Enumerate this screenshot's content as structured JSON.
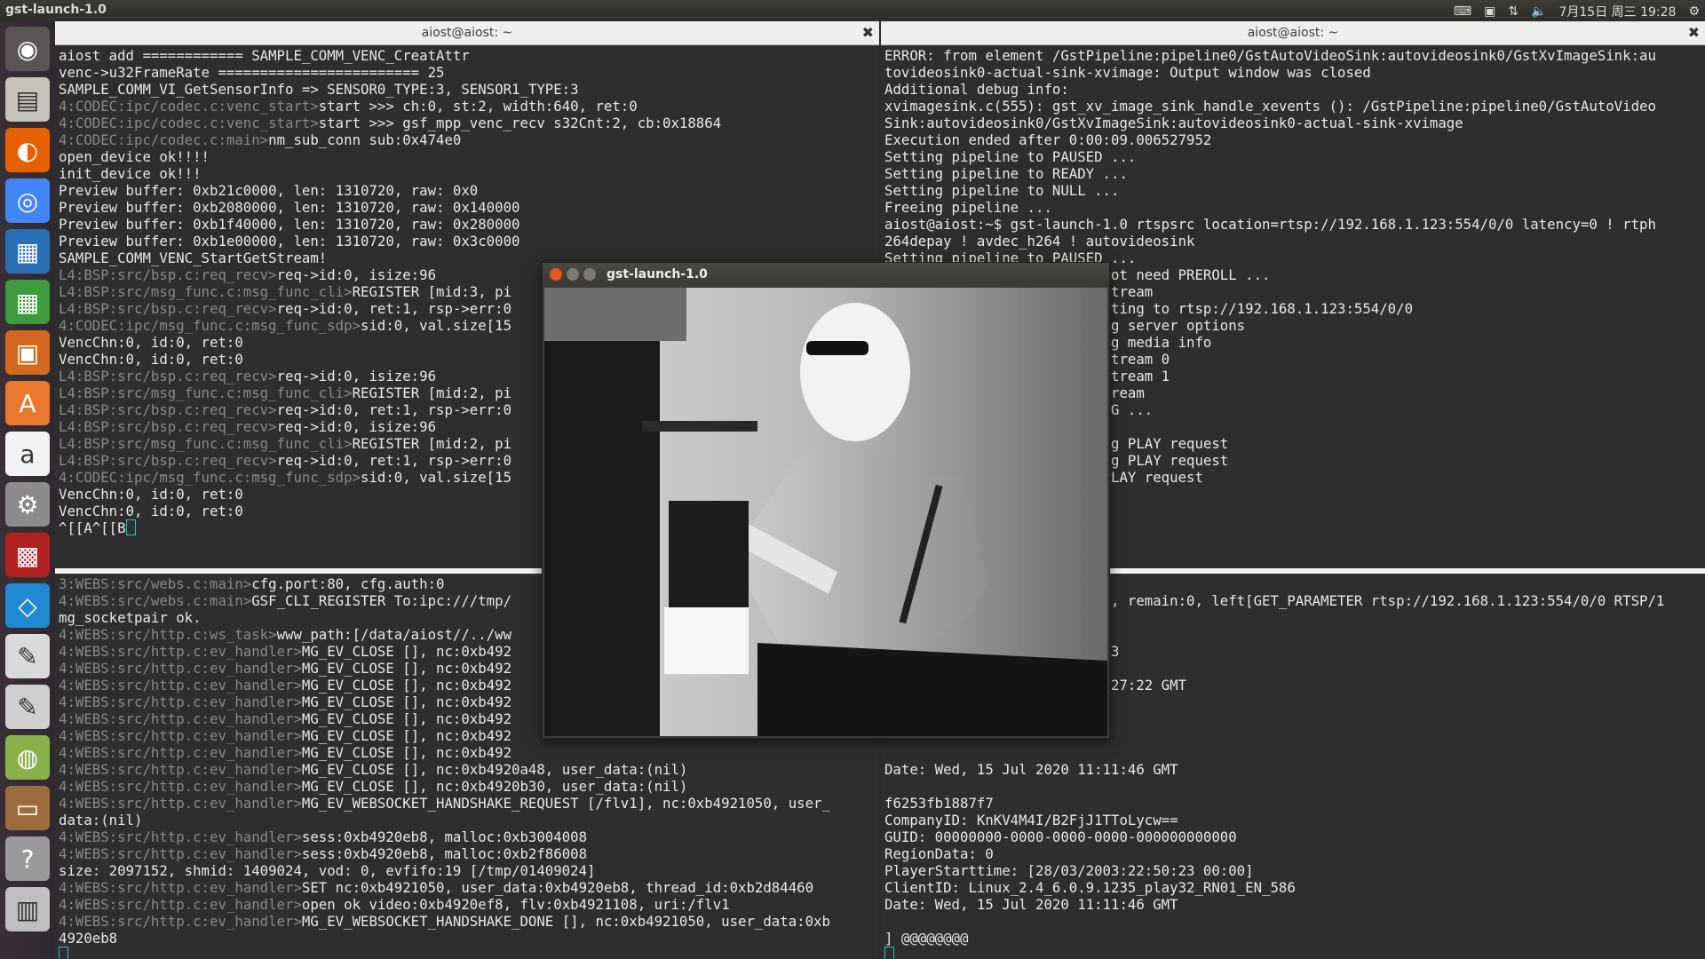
{
  "topbar": {
    "app_name": "gst-launch-1.0",
    "clock": "7月15日 周三 19:28"
  },
  "launcher": [
    {
      "icon": "dash-home-icon",
      "color": "#5a5656"
    },
    {
      "icon": "files-icon",
      "color": "#c7c3bc"
    },
    {
      "icon": "firefox-icon",
      "color": "#e66000"
    },
    {
      "icon": "chrome-icon",
      "color": "#4285f4"
    },
    {
      "icon": "writer-icon",
      "color": "#2a6fb6"
    },
    {
      "icon": "calc-icon",
      "color": "#3e9a3e"
    },
    {
      "icon": "impress-icon",
      "color": "#d2691e"
    },
    {
      "icon": "software-center-icon",
      "color": "#e9772e"
    },
    {
      "icon": "amazon-icon",
      "color": "#f3f3f3"
    },
    {
      "icon": "system-settings-icon",
      "color": "#8b8b8b"
    },
    {
      "icon": "media-icon",
      "color": "#b22222"
    },
    {
      "icon": "vscode-icon",
      "color": "#1f8ad2"
    },
    {
      "icon": "pdf-viewer-icon",
      "color": "#d9d9d9"
    },
    {
      "icon": "text-editor-icon",
      "color": "#cfcfcf"
    },
    {
      "icon": "image-viewer-icon",
      "color": "#88b04b"
    },
    {
      "icon": "disk-icon",
      "color": "#9c6b3e"
    },
    {
      "icon": "help-icon",
      "color": "#9a9a9a"
    },
    {
      "icon": "trash-icon",
      "color": "#bfbfbf"
    }
  ],
  "term_left": {
    "title": "aiost@aiost: ~",
    "top_lines": [
      [
        "aiost add ============ SAMPLE_COMM_VENC_CreatAttr",
        ""
      ],
      [
        "venc->u32FrameRate ======================== 25",
        ""
      ],
      [
        "SAMPLE_COMM_VI_GetSensorInfo => SENSOR0_TYPE:3, SENSOR1_TYPE:3",
        ""
      ],
      [
        "start >>> ch:0, st:2, width:640, ret:0",
        "4:CODEC:ipc/codec.c:venc_start>"
      ],
      [
        "start >>> gsf_mpp_venc_recv s32Cnt:2, cb:0x18864",
        "4:CODEC:ipc/codec.c:venc_start>"
      ],
      [
        "nm_sub_conn sub:0x474e0",
        "4:CODEC:ipc/codec.c:main>"
      ],
      [
        "open_device ok!!!!",
        ""
      ],
      [
        "init_device ok!!!",
        ""
      ],
      [
        "Preview buffer: 0xb21c0000, len: 1310720, raw: 0x0",
        ""
      ],
      [
        "Preview buffer: 0xb2080000, len: 1310720, raw: 0x140000",
        ""
      ],
      [
        "Preview buffer: 0xb1f40000, len: 1310720, raw: 0x280000",
        ""
      ],
      [
        "Preview buffer: 0xb1e00000, len: 1310720, raw: 0x3c0000",
        ""
      ],
      [
        "SAMPLE_COMM_VENC_StartGetStream!",
        ""
      ],
      [
        "req->id:0, isize:96",
        "L4:BSP:src/bsp.c:req_recv>"
      ],
      [
        "REGISTER [mid:3, pi",
        "L4:BSP:src/msg_func.c:msg_func_cli>"
      ],
      [
        "req->id:0, ret:1, rsp->err:0",
        "L4:BSP:src/bsp.c:req_recv>"
      ],
      [
        "sid:0, val.size[15",
        "4:CODEC:ipc/msg_func.c:msg_func_sdp>"
      ],
      [
        "VencChn:0, id:0, ret:0",
        ""
      ],
      [
        "VencChn:0, id:0, ret:0",
        ""
      ],
      [
        "req->id:0, isize:96",
        "L4:BSP:src/bsp.c:req_recv>"
      ],
      [
        "REGISTER [mid:2, pi",
        "L4:BSP:src/msg_func.c:msg_func_cli>"
      ],
      [
        "req->id:0, ret:1, rsp->err:0",
        "L4:BSP:src/bsp.c:req_recv>"
      ],
      [
        "req->id:0, isize:96",
        "L4:BSP:src/bsp.c:req_recv>"
      ],
      [
        "REGISTER [mid:2, pi",
        "L4:BSP:src/msg_func.c:msg_func_cli>"
      ],
      [
        "req->id:0, ret:1, rsp->err:0",
        "L4:BSP:src/bsp.c:req_recv>"
      ],
      [
        "sid:0, val.size[15",
        "4:CODEC:ipc/msg_func.c:msg_func_sdp>"
      ],
      [
        "VencChn:0, id:0, ret:0",
        ""
      ],
      [
        "VencChn:0, id:0, ret:0",
        ""
      ],
      [
        "^[[A^[[B",
        ""
      ]
    ],
    "bottom_lines": [
      [
        "cfg.port:80, cfg.auth:0",
        "3:WEBS:src/webs.c:main>"
      ],
      [
        "GSF_CLI_REGISTER To:ipc:///tmp/",
        "4:WEBS:src/webs.c:main>"
      ],
      [
        "mg_socketpair ok.",
        ""
      ],
      [
        "www_path:[/data/aiost//../ww",
        "4:WEBS:src/http.c:ws_task>"
      ],
      [
        "MG_EV_CLOSE [], nc:0xb492",
        "4:WEBS:src/http.c:ev_handler>"
      ],
      [
        "MG_EV_CLOSE [], nc:0xb492",
        "4:WEBS:src/http.c:ev_handler>"
      ],
      [
        "MG_EV_CLOSE [], nc:0xb492",
        "4:WEBS:src/http.c:ev_handler>"
      ],
      [
        "MG_EV_CLOSE [], nc:0xb492",
        "4:WEBS:src/http.c:ev_handler>"
      ],
      [
        "MG_EV_CLOSE [], nc:0xb492",
        "4:WEBS:src/http.c:ev_handler>"
      ],
      [
        "MG_EV_CLOSE [], nc:0xb492",
        "4:WEBS:src/http.c:ev_handler>"
      ],
      [
        "MG_EV_CLOSE [], nc:0xb492",
        "4:WEBS:src/http.c:ev_handler>"
      ],
      [
        "MG_EV_CLOSE [], nc:0xb4920a48, user_data:(nil)",
        "4:WEBS:src/http.c:ev_handler>"
      ],
      [
        "MG_EV_CLOSE [], nc:0xb4920b30, user_data:(nil)",
        "4:WEBS:src/http.c:ev_handler>"
      ],
      [
        "MG_EV_WEBSOCKET_HANDSHAKE_REQUEST [/flv1], nc:0xb4921050, user_",
        "4:WEBS:src/http.c:ev_handler>"
      ],
      [
        "data:(nil)",
        ""
      ],
      [
        "sess:0xb4920eb8, malloc:0xb3004008",
        "4:WEBS:src/http.c:ev_handler>"
      ],
      [
        "sess:0xb4920eb8, malloc:0xb2f86008",
        "4:WEBS:src/http.c:ev_handler>"
      ],
      [
        "size: 2097152, shmid: 1409024, vod: 0, evfifo:19 [/tmp/01409024]",
        ""
      ],
      [
        "SET nc:0xb4921050, user_data:0xb4920eb8, thread_id:0xb2d84460",
        "4:WEBS:src/http.c:ev_handler>"
      ],
      [
        "open ok video:0xb4920ef8, flv:0xb4921108, uri:/flv1",
        "4:WEBS:src/http.c:ev_handler>"
      ],
      [
        "MG_EV_WEBSOCKET_HANDSHAKE_DONE [], nc:0xb4921050, user_data:0xb",
        "4:WEBS:src/http.c:ev_handler>"
      ],
      [
        "4920eb8",
        ""
      ]
    ]
  },
  "term_right": {
    "title": "aiost@aiost: ~",
    "top_lines": [
      "ERROR: from element /GstPipeline:pipeline0/GstAutoVideoSink:autovideosink0/GstXvImageSink:au",
      "tovideosink0-actual-sink-xvimage: Output window was closed",
      "Additional debug info:",
      "xvimagesink.c(555): gst_xv_image_sink_handle_xevents (): /GstPipeline:pipeline0/GstAutoVideo",
      "Sink:autovideosink0/GstXvImageSink:autovideosink0-actual-sink-xvimage",
      "Execution ended after 0:00:09.006527952",
      "Setting pipeline to PAUSED ...",
      "Setting pipeline to READY ...",
      "Setting pipeline to NULL ...",
      "Freeing pipeline ...",
      "aiost@aiost:~$ gst-launch-1.0 rtspsrc location=rtsp://192.168.1.123:554/0/0 latency=0 ! rtph",
      "264depay ! avdec_h264 ! autovideosink",
      "Setting pipeline to PAUSED ...",
      "                          not need PREROLL ...",
      "                          Stream",
      "                          cting to rtsp://192.168.1.123:554/0/0",
      "                          ng server options",
      "                          ng media info",
      "                          stream 0",
      "                          stream 1",
      "                          tream",
      "                          NG ...",
      "",
      "                          ng PLAY request",
      "                          ng PLAY request",
      "                          PLAY request"
    ],
    "bottom_lines": [
      "",
      "                          0, remain:0, left[GET_PARAMETER rtsp://192.168.1.123:554/0/0 RTSP/1",
      "",
      "",
      "                          .3",
      "",
      "                          :27:22 GMT",
      "",
      "",
      "",
      "",
      "Date: Wed, 15 Jul 2020 11:11:46 GMT",
      "",
      "f6253fb1887f7",
      "CompanyID: KnKV4M4I/B2FjJ1TToLycw==",
      "GUID: 00000000-0000-0000-0000-000000000000",
      "RegionData: 0",
      "PlayerStarttime: [28/03/2003:22:50:23 00:00]",
      "ClientID: Linux_2.4_6.0.9.1235_play32_RN01_EN_586",
      "Date: Wed, 15 Jul 2020 11:11:46 GMT",
      "",
      "] @@@@@@@@"
    ]
  },
  "video_window": {
    "title": "gst-launch-1.0",
    "content": "thermal camera view of seated person wearing sunglasses"
  }
}
